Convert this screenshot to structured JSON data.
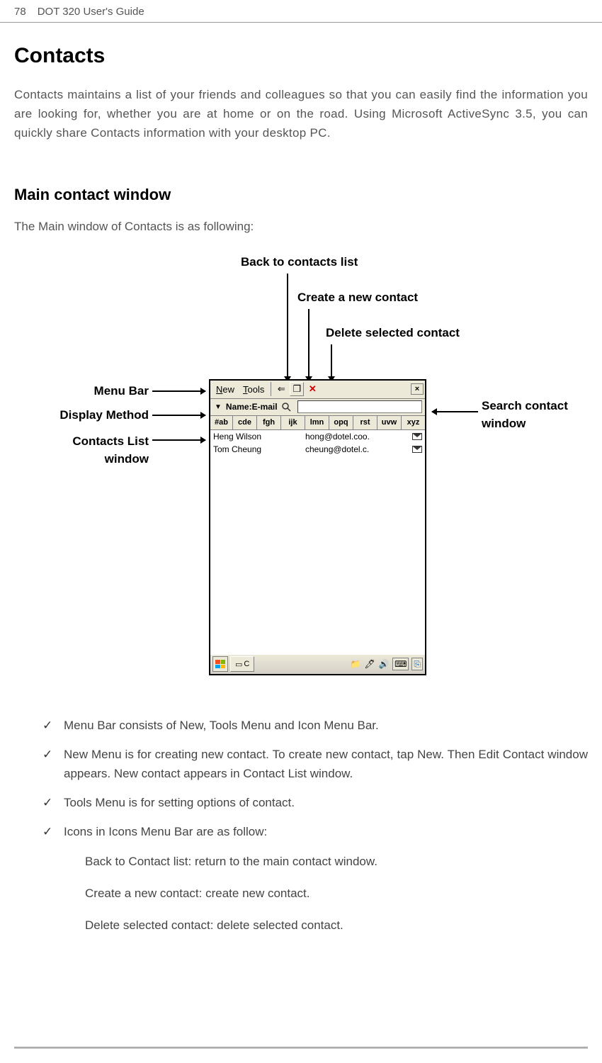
{
  "header": {
    "page_number": "78",
    "guide_title": "DOT 320 User's Guide"
  },
  "section": {
    "title": "Contacts",
    "intro": "Contacts maintains a list of your friends and colleagues so that you can easily find the information you are looking for, whether you are at home or on the road. Using Microsoft ActiveSync 3.5, you can quickly share Contacts information with your desktop PC."
  },
  "subsection": {
    "title": "Main contact window",
    "intro": "The Main window of Contacts is as following:"
  },
  "callouts": {
    "back_to_list": "Back to contacts list",
    "create_new": "Create a new contact",
    "delete_selected": "Delete selected contact",
    "menu_bar": "Menu Bar",
    "display_method": "Display Method",
    "contacts_list_window": "Contacts List window",
    "search_window": "Search contact window"
  },
  "app": {
    "menu": {
      "new": "New",
      "tools": "Tools"
    },
    "toolbar": {
      "back_glyph": "⇐",
      "new_glyph": "❐",
      "delete_glyph": "✕",
      "close_glyph": "×"
    },
    "display": {
      "label": "Name:E-mail",
      "search_placeholder": ""
    },
    "alpha_tabs": [
      "#ab",
      "cde",
      "fgh",
      "ijk",
      "lmn",
      "opq",
      "rst",
      "uvw",
      "xyz"
    ],
    "contacts": [
      {
        "name": "Heng Wilson",
        "email": "hong@dotel.coo."
      },
      {
        "name": "Tom Cheung",
        "email": "cheung@dotel.c."
      }
    ],
    "taskbar": {
      "app_label": "C"
    }
  },
  "bullets": {
    "b1": "Menu Bar consists of New, Tools Menu and Icon Menu Bar.",
    "b2": "New Menu is for creating new contact. To create new contact, tap New. Then Edit Contact window appears. New contact appears in Contact List window.",
    "b3": "Tools Menu is for setting options of contact.",
    "b4": "Icons in Icons Menu Bar are as follow:",
    "sub1": "Back to Contact list: return to the main contact window.",
    "sub2": "Create a new contact: create new contact.",
    "sub3": "Delete selected contact: delete selected contact."
  }
}
